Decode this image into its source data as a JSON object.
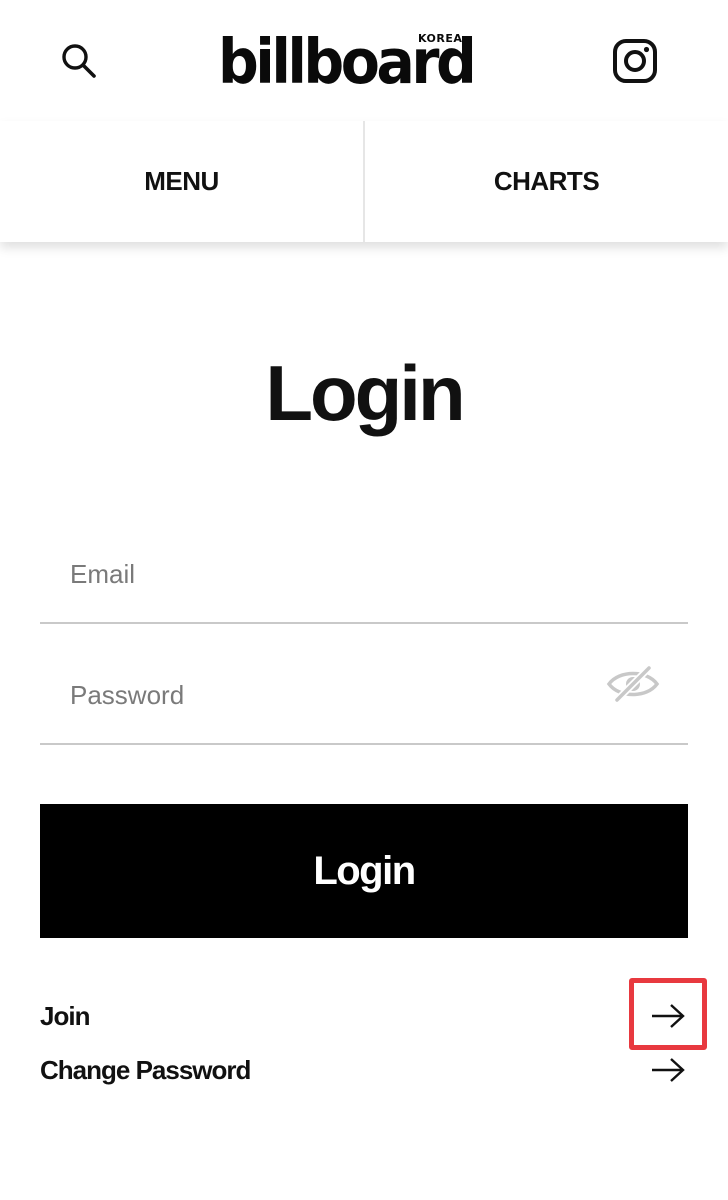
{
  "header": {
    "logo_text": "billboard",
    "logo_sub": "KOREA",
    "search_icon": "search-icon",
    "instagram_icon": "instagram-icon"
  },
  "tabs": [
    {
      "label": "MENU"
    },
    {
      "label": "CHARTS"
    }
  ],
  "login": {
    "title": "Login",
    "email_placeholder": "Email",
    "password_placeholder": "Password",
    "password_toggle_icon": "eye-slash-icon",
    "button_label": "Login"
  },
  "links": [
    {
      "label": "Join",
      "icon": "arrow-right-icon",
      "highlighted": true
    },
    {
      "label": "Change Password",
      "icon": "arrow-right-icon",
      "highlighted": false
    }
  ],
  "colors": {
    "highlight": "#e8393f",
    "button_bg": "#000000",
    "button_text": "#ffffff",
    "placeholder": "#7a7a7a"
  }
}
